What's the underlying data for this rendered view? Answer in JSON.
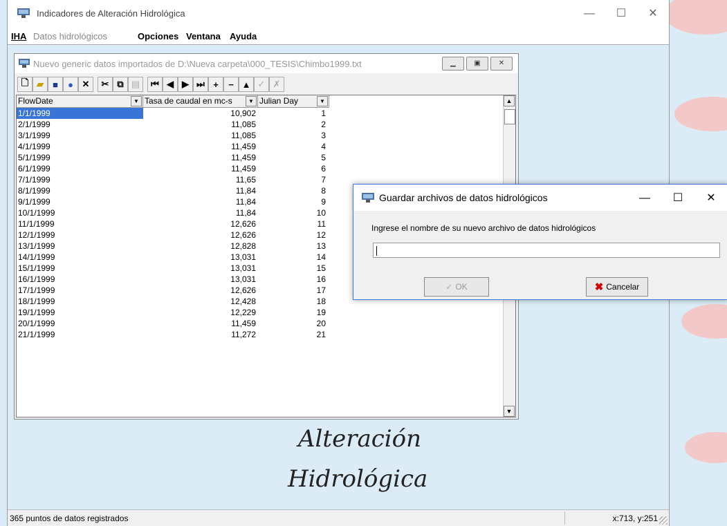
{
  "app": {
    "title": "Indicadores de Alteración Hidrológica",
    "minimize": "—",
    "maximize": "☐",
    "close": "✕"
  },
  "menu": {
    "items": [
      "IHA",
      "Datos hidrológicos",
      "Opciones",
      "Ventana",
      "Ayuda"
    ]
  },
  "child_window": {
    "title": "Nuevo generic datos importados de D:\\Nueva carpeta\\000_TESIS\\Chimbo1999.txt",
    "columns": [
      "FlowDate",
      "Tasa de caudal en mc-s",
      "Julian Day"
    ],
    "rows": [
      [
        "1/1/1999",
        "10,902",
        "1"
      ],
      [
        "2/1/1999",
        "11,085",
        "2"
      ],
      [
        "3/1/1999",
        "11,085",
        "3"
      ],
      [
        "4/1/1999",
        "11,459",
        "4"
      ],
      [
        "5/1/1999",
        "11,459",
        "5"
      ],
      [
        "6/1/1999",
        "11,459",
        "6"
      ],
      [
        "7/1/1999",
        "11,65",
        "7"
      ],
      [
        "8/1/1999",
        "11,84",
        "8"
      ],
      [
        "9/1/1999",
        "11,84",
        "9"
      ],
      [
        "10/1/1999",
        "11,84",
        "10"
      ],
      [
        "11/1/1999",
        "12,626",
        "11"
      ],
      [
        "12/1/1999",
        "12,626",
        "12"
      ],
      [
        "13/1/1999",
        "12,828",
        "13"
      ],
      [
        "14/1/1999",
        "13,031",
        "14"
      ],
      [
        "15/1/1999",
        "13,031",
        "15"
      ],
      [
        "16/1/1999",
        "13,031",
        "16"
      ],
      [
        "17/1/1999",
        "12,626",
        "17"
      ],
      [
        "18/1/1999",
        "12,428",
        "18"
      ],
      [
        "19/1/1999",
        "12,229",
        "19"
      ],
      [
        "20/1/1999",
        "11,459",
        "20"
      ],
      [
        "21/1/1999",
        "11,272",
        "21"
      ]
    ]
  },
  "background_text": {
    "line1": "Alteración",
    "line2": "Hidrológica"
  },
  "dialog": {
    "title": "Guardar archivos de datos hidrológicos",
    "prompt": "Ingrese el nombre de su nuevo archivo de datos hidrológicos",
    "input_value": "",
    "ok_label": "OK",
    "cancel_label": "Cancelar"
  },
  "status": {
    "left": "365 puntos de datos registrados",
    "right": "x:713, y:251"
  },
  "colors": {
    "selection": "#3875d7",
    "desktop": "#dcecf7",
    "cancel_icon": "#d00000"
  }
}
